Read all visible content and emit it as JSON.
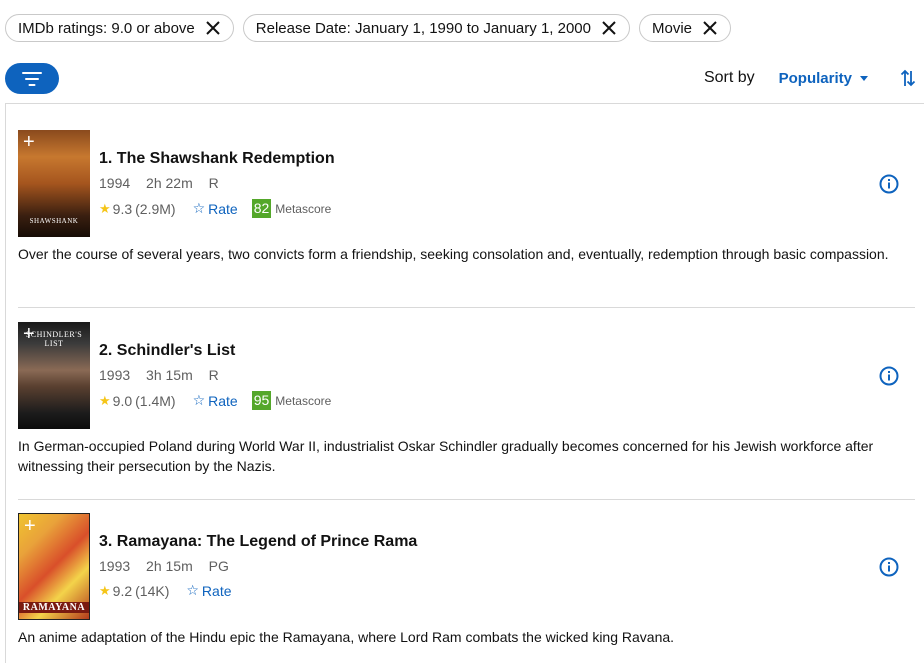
{
  "filters": [
    {
      "label": "IMDb ratings: 9.0 or above"
    },
    {
      "label": "Release Date: January 1, 1990 to January 1, 2000"
    },
    {
      "label": "Movie"
    }
  ],
  "sort": {
    "label": "Sort by",
    "value": "Popularity"
  },
  "colors": {
    "accent": "#0e63be",
    "star": "#f5c518",
    "metascore": "#54a72a"
  },
  "movies": [
    {
      "title": "1. The Shawshank Redemption",
      "year": "1994",
      "runtime": "2h 22m",
      "certificate": "R",
      "rating": "9.3",
      "votes": "(2.9M)",
      "rate_label": "Rate",
      "metascore": "82",
      "metascore_label": "Metascore",
      "poster_text": "SHAWSHANK",
      "description": "Over the course of several years, two convicts form a friendship, seeking consolation and, eventually, redemption through basic compassion."
    },
    {
      "title": "2. Schindler's List",
      "year": "1993",
      "runtime": "3h 15m",
      "certificate": "R",
      "rating": "9.0",
      "votes": "(1.4M)",
      "rate_label": "Rate",
      "metascore": "95",
      "metascore_label": "Metascore",
      "poster_text": "SCHINDLER'S LIST",
      "description": "In German-occupied Poland during World War II, industrialist Oskar Schindler gradually becomes concerned for his Jewish workforce after witnessing their persecution by the Nazis."
    },
    {
      "title": "3. Ramayana: The Legend of Prince Rama",
      "year": "1993",
      "runtime": "2h 15m",
      "certificate": "PG",
      "rating": "9.2",
      "votes": "(14K)",
      "rate_label": "Rate",
      "poster_text": "RAMAYANA",
      "description": "An anime adaptation of the Hindu epic the Ramayana, where Lord Ram combats the wicked king Ravana."
    }
  ]
}
